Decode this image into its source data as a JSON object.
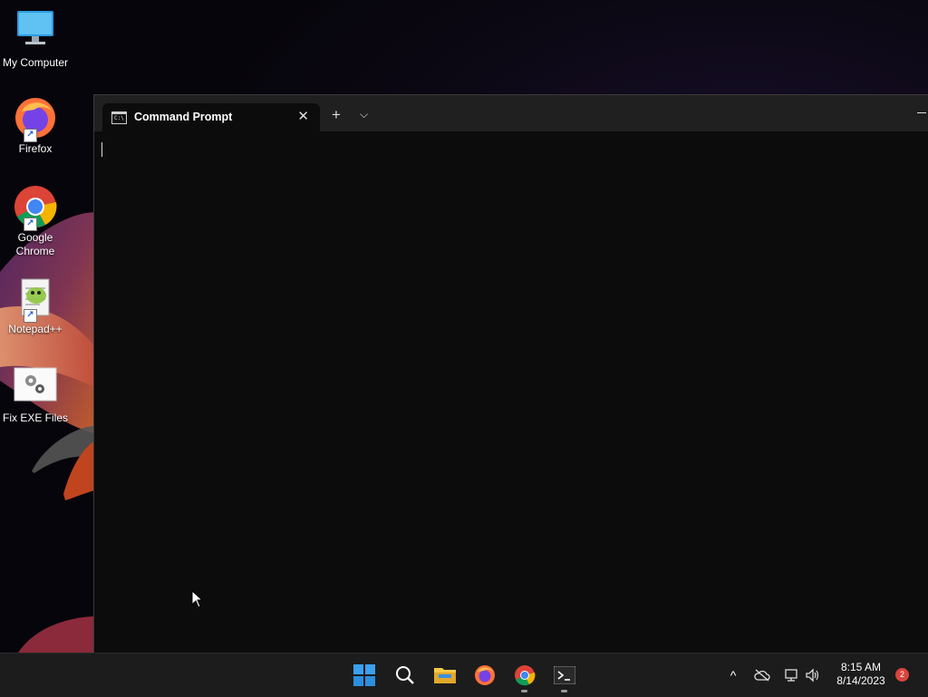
{
  "desktop": {
    "icons": [
      {
        "label": "My Computer"
      },
      {
        "label": "Firefox"
      },
      {
        "label": "Google Chrome"
      },
      {
        "label": "Notepad++"
      },
      {
        "label": "Fix EXE Files"
      }
    ]
  },
  "window": {
    "tab_title": "Command Prompt",
    "tab_close_glyph": "✕",
    "new_tab_glyph": "+",
    "dropdown_glyph": "⌵"
  },
  "taskbar": {
    "apps": [
      "start-icon",
      "search-icon",
      "file-explorer-icon",
      "firefox-icon",
      "chrome-icon",
      "terminal-icon"
    ],
    "tray_chevron": "^",
    "clock_time": "8:15 AM",
    "clock_date": "8/14/2023",
    "notification_count": "2"
  },
  "colors": {
    "terminal_bg": "#0c0c0c",
    "titlebar_bg": "#202020",
    "taskbar_bg": "#1c1c1c",
    "badge": "#d8443e"
  }
}
